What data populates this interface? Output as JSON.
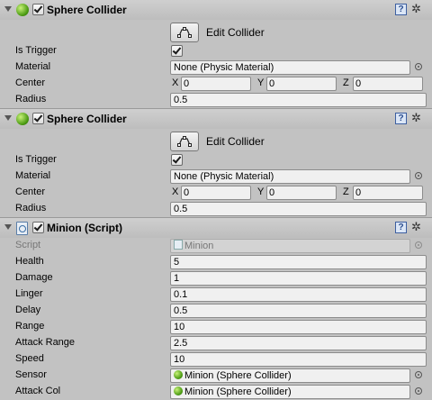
{
  "components": [
    {
      "title": "Sphere Collider",
      "edit_label": "Edit Collider",
      "is_trigger_label": "Is Trigger",
      "material_label": "Material",
      "material_value": "None (Physic Material)",
      "center_label": "Center",
      "center": {
        "x_label": "X",
        "x": "0",
        "y_label": "Y",
        "y": "0",
        "z_label": "Z",
        "z": "0"
      },
      "radius_label": "Radius",
      "radius_value": "0.5"
    },
    {
      "title": "Sphere Collider",
      "edit_label": "Edit Collider",
      "is_trigger_label": "Is Trigger",
      "material_label": "Material",
      "material_value": "None (Physic Material)",
      "center_label": "Center",
      "center": {
        "x_label": "X",
        "x": "0",
        "y_label": "Y",
        "y": "0",
        "z_label": "Z",
        "z": "0"
      },
      "radius_label": "Radius",
      "radius_value": "0.5"
    }
  ],
  "script_component": {
    "title": "Minion (Script)",
    "script_label": "Script",
    "script_value": "Minion",
    "fields": [
      {
        "label": "Health",
        "value": "5"
      },
      {
        "label": "Damage",
        "value": "1"
      },
      {
        "label": "Linger",
        "value": "0.1"
      },
      {
        "label": "Delay",
        "value": "0.5"
      },
      {
        "label": "Range",
        "value": "10"
      },
      {
        "label": "Attack Range",
        "value": "2.5"
      },
      {
        "label": "Speed",
        "value": "10"
      }
    ],
    "sensor_label": "Sensor",
    "sensor_value": "Minion (Sphere Collider)",
    "attack_col_label": "Attack Col",
    "attack_col_value": "Minion (Sphere Collider)"
  },
  "icons": {
    "foldout": "foldout-arrow-icon",
    "sphere_collider": "sphere-collider-icon",
    "script": "script-icon",
    "help": "help-book-icon",
    "gear": "gear-icon",
    "edit_collider": "edit-collider-icon",
    "object_picker": "object-picker-icon"
  },
  "help_glyph": "?",
  "gear_glyph": "✲"
}
